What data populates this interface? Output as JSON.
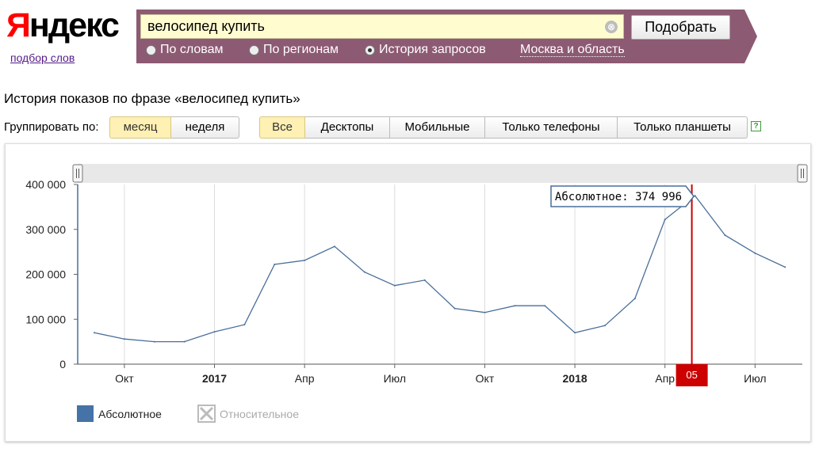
{
  "logo": {
    "text_first": "Я",
    "text_rest": "ндекс",
    "sub_link": "подбор слов"
  },
  "search": {
    "query": "велосипед купить",
    "clear_glyph": "⊗",
    "submit_label": "Подобрать",
    "modes": [
      {
        "label": "По словам",
        "checked": false
      },
      {
        "label": "По регионам",
        "checked": false
      },
      {
        "label": "История запросов",
        "checked": true
      }
    ],
    "region": "Москва и область"
  },
  "history": {
    "title": "История показов по фразе «велосипед купить»",
    "group_label": "Группировать по:",
    "group_options": [
      {
        "label": "месяц",
        "active": true
      },
      {
        "label": "неделя",
        "active": false
      }
    ],
    "device_options": [
      {
        "label": "Все",
        "active": true
      },
      {
        "label": "Десктопы",
        "active": false
      },
      {
        "label": "Мобильные",
        "active": false
      },
      {
        "label": "Только телефоны",
        "active": false
      },
      {
        "label": "Только планшеты",
        "active": false
      }
    ],
    "help_glyph": "?"
  },
  "chart_data": {
    "type": "line",
    "y_ticks": [
      "0",
      "100 000",
      "200 000",
      "300 000",
      "400 000"
    ],
    "ylim": [
      0,
      400000
    ],
    "x_tick_labels": [
      {
        "label": "Окт",
        "bold": false
      },
      {
        "label": "2017",
        "bold": true
      },
      {
        "label": "Апр",
        "bold": false
      },
      {
        "label": "Июл",
        "bold": false
      },
      {
        "label": "Окт",
        "bold": false
      },
      {
        "label": "2018",
        "bold": true
      },
      {
        "label": "Апр",
        "bold": false
      },
      {
        "label": "Июл",
        "bold": false
      }
    ],
    "series": [
      {
        "values": [
          70000,
          56000,
          50000,
          50000,
          72000,
          88000,
          222000,
          231000,
          262000,
          205000,
          175000,
          187000,
          124000,
          115000,
          130000,
          130000,
          70000,
          86000,
          146000,
          322000,
          374996,
          287000,
          247000,
          216000
        ]
      }
    ],
    "tooltip": {
      "text": "Абсолютное: 374 996",
      "index": 20
    },
    "cursor_label": "05",
    "legend": [
      {
        "label": "Абсолютное",
        "active": true,
        "color": "#4572a7"
      },
      {
        "label": "Относительное",
        "active": false,
        "color": "#bbbbbb"
      }
    ],
    "grid": "vertical"
  },
  "colors": {
    "line": "#4a6f9a",
    "cursor": "#cc0000",
    "band": "#8d5a73"
  },
  "icons": {
    "handle_left": "drag-handle-icon",
    "handle_right": "drag-handle-icon",
    "help": "help-icon"
  }
}
